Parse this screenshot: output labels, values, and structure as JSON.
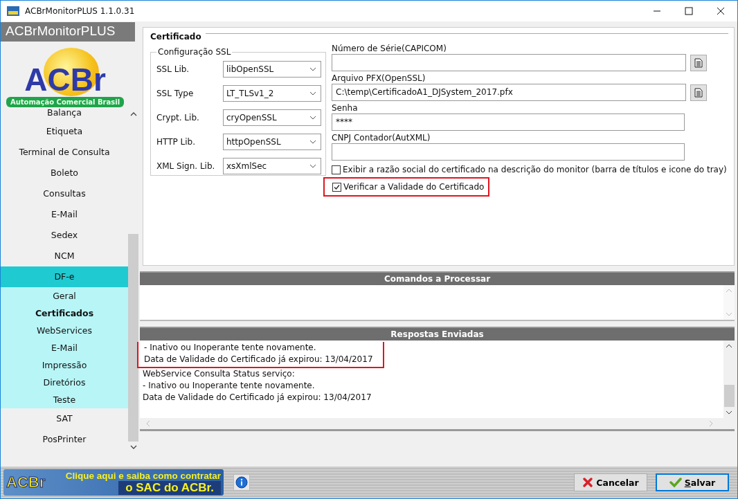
{
  "window": {
    "title": "ACBrMonitorPLUS 1.1.0.31"
  },
  "header": {
    "title": "ACBrMonitorPLUS"
  },
  "logo": {
    "text": "ACBr",
    "subtitle": "Automação Comercial Brasil"
  },
  "sidebar": {
    "items": [
      {
        "label": "Balança",
        "selected": false
      },
      {
        "label": "Etiqueta",
        "selected": false
      },
      {
        "label": "Terminal de Consulta",
        "selected": false
      },
      {
        "label": "Boleto",
        "selected": false
      },
      {
        "label": "Consultas",
        "selected": false
      },
      {
        "label": "E-Mail",
        "selected": false
      },
      {
        "label": "Sedex",
        "selected": false
      },
      {
        "label": "NCM",
        "selected": false
      },
      {
        "label": "DF-e",
        "selected": false,
        "expanded": true,
        "children": [
          {
            "label": "Geral",
            "selected": false
          },
          {
            "label": "Certificados",
            "selected": true
          },
          {
            "label": "WebServices",
            "selected": false
          },
          {
            "label": "E-Mail",
            "selected": false
          },
          {
            "label": "Impressão",
            "selected": false
          },
          {
            "label": "Diretórios",
            "selected": false
          },
          {
            "label": "Teste",
            "selected": false
          }
        ]
      },
      {
        "label": "SAT",
        "selected": false
      },
      {
        "label": "PosPrinter",
        "selected": false
      }
    ]
  },
  "certificado": {
    "title": "Certificado",
    "ssl": {
      "title": "Configuração SSL",
      "rows": [
        {
          "label": "SSL Lib.",
          "value": "libOpenSSL"
        },
        {
          "label": "SSL Type",
          "value": "LT_TLSv1_2"
        },
        {
          "label": "Crypt. Lib.",
          "value": "cryOpenSSL"
        },
        {
          "label": "HTTP Lib.",
          "value": "httpOpenSSL"
        },
        {
          "label": "XML Sign. Lib.",
          "value": "xsXmlSec"
        }
      ]
    },
    "fields": [
      {
        "label": "Número de Série(CAPICOM)",
        "browse": true
      },
      {
        "label": "Arquivo PFX(OpenSSL)",
        "value": "C:\\temp\\CertificadoA1_DJSystem_2017.pfx",
        "browse": true
      },
      {
        "label": "Senha",
        "value": "****",
        "browse": false
      },
      {
        "label": "CNPJ Contador(AutXML)",
        "browse": false
      }
    ],
    "checkboxes": [
      {
        "label": "Exibir a razão social do certificado na descrição do monitor (barra de títulos e icone do tray)",
        "checked": false,
        "highlighted": false
      },
      {
        "label": "Verificar a Validade do Certificado",
        "checked": true,
        "highlighted": true
      }
    ]
  },
  "commands": {
    "title": "Comandos a Processar"
  },
  "responses": {
    "title": "Respostas Enviadas",
    "lines": [
      {
        "text": "- Inativo ou Inoperante tente novamente.",
        "highlighted": true
      },
      {
        "text": "Data de Validade do Certificado já expirou: 13/04/2017",
        "highlighted": true
      },
      {
        "text": "WebService Consulta Status serviço:",
        "highlighted": false
      },
      {
        "text": "- Inativo ou Inoperante tente novamente.",
        "highlighted": false
      },
      {
        "text": "Data de Validade do Certificado já expirou: 13/04/2017",
        "highlighted": false
      }
    ]
  },
  "banner": {
    "line1": "Clique aqui e saiba como contratar",
    "line2": "o SAC do ACBr.",
    "logo": "ACBr"
  },
  "buttons": [
    {
      "kind": "cancel",
      "label": "Cancelar"
    },
    {
      "kind": "save",
      "accel": "S",
      "label": "alvar"
    }
  ]
}
